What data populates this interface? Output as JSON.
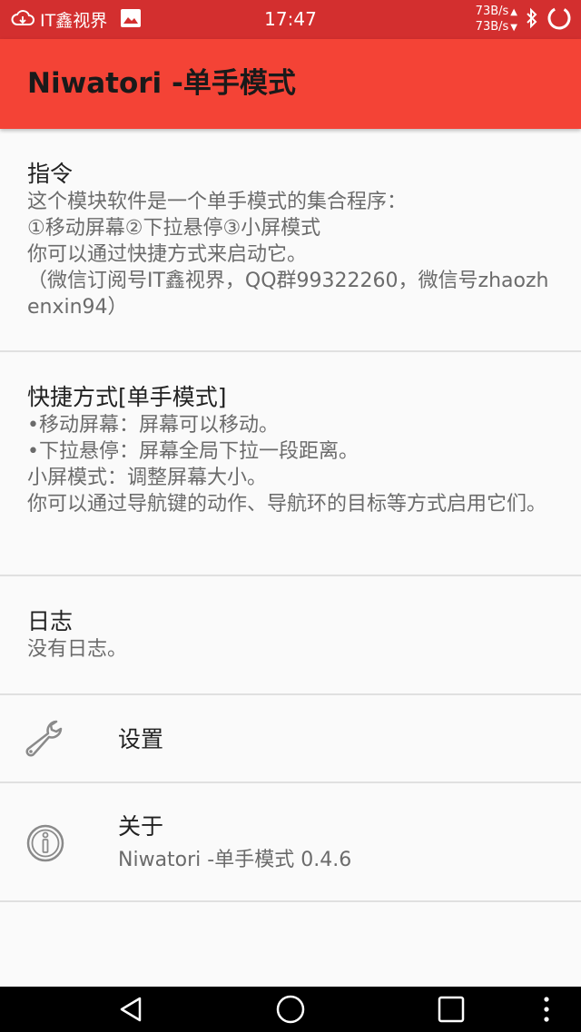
{
  "status_bar": {
    "carrier": "IT鑫视界",
    "time": "17:47",
    "net_up": "73B/s",
    "net_down": "73B/s",
    "icons": [
      "cloud-icon",
      "image-icon",
      "bluetooth-icon",
      "loading-ring-icon"
    ]
  },
  "app_bar": {
    "title": "Niwatori -单手模式",
    "color": "#f44336",
    "status_color": "#d32f2f"
  },
  "prefs": {
    "instructions": {
      "title": "指令",
      "summary": "这个模块软件是一个单手模式的集合程序：\n①移动屏幕②下拉悬停③小屏模式\n你可以通过快捷方式来启动它。\n（微信订阅号IT鑫视界，QQ群99322260，微信号zhaozhenxin94）"
    },
    "shortcut": {
      "title": "快捷方式[单手模式]",
      "summary": "•移动屏幕：屏幕可以移动。\n•下拉悬停：屏幕全局下拉一段距离。\n小屏模式：调整屏幕大小。\n你可以通过导航键的动作、导航环的目标等方式启用它们。"
    },
    "log": {
      "title": "日志",
      "summary": "没有日志。"
    },
    "settings": {
      "title": "设置",
      "icon": "wrench-icon"
    },
    "about": {
      "title": "关于",
      "summary": "Niwatori -单手模式 0.4.6",
      "icon": "info-icon"
    }
  },
  "nav_bar": {
    "icons": [
      "back-icon",
      "home-icon",
      "recents-icon",
      "menu-icon"
    ]
  }
}
